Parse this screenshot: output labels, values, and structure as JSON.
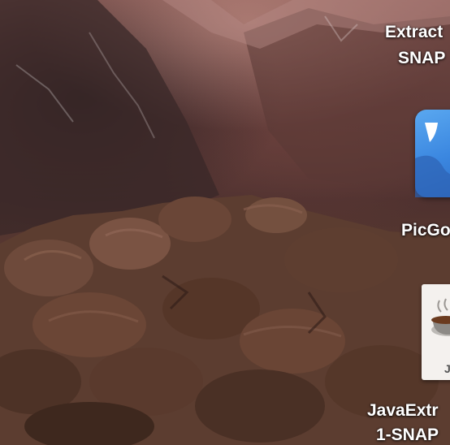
{
  "desktop": {
    "icons": [
      {
        "label_line1": "Extract",
        "label_line2": "SNAP",
        "icon": "document-icon"
      },
      {
        "label_line1": "PicGo",
        "icon": "picgo-app-icon"
      },
      {
        "label_line1": "JavaExtr",
        "label_line2": "1-SNAP",
        "icon": "java-jar-icon",
        "badge": "J"
      }
    ]
  }
}
